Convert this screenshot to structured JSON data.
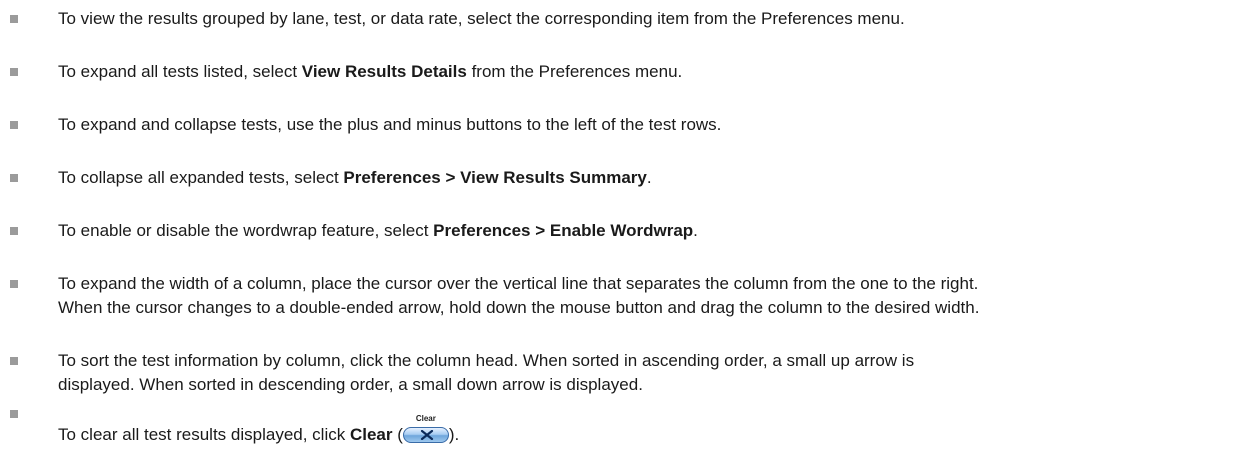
{
  "items": [
    {
      "pre": "To view the results grouped by lane, test, or data rate, select the corresponding item from the Preferences menu.",
      "bold": "",
      "post": ""
    },
    {
      "pre": "To expand all tests listed, select ",
      "bold": "View Results Details",
      "post": " from the Preferences menu."
    },
    {
      "pre": "To expand and collapse tests, use the plus and minus buttons to the left of the test rows.",
      "bold": "",
      "post": ""
    },
    {
      "pre": "To collapse all expanded tests, select ",
      "bold": "Preferences > View Results Summary",
      "post": "."
    },
    {
      "pre": "To enable or disable the wordwrap feature, select ",
      "bold": "Preferences > Enable Wordwrap",
      "post": "."
    },
    {
      "line1": "To expand the width of a column, place the cursor over the vertical line that separates the column from the one to the right.",
      "line2": "When the cursor changes to a double-ended arrow, hold down the mouse button and drag the column to the desired width."
    },
    {
      "line1": "To sort the test information by column, click the column head. When sorted in ascending order, a small up arrow is",
      "line2": "displayed. When sorted in descending order, a small down arrow is displayed."
    },
    {
      "pre": "To clear all test results displayed, click ",
      "bold": "Clear",
      "open": " (",
      "post": ").",
      "button_label": "Clear",
      "button_icon": "x-icon"
    }
  ]
}
